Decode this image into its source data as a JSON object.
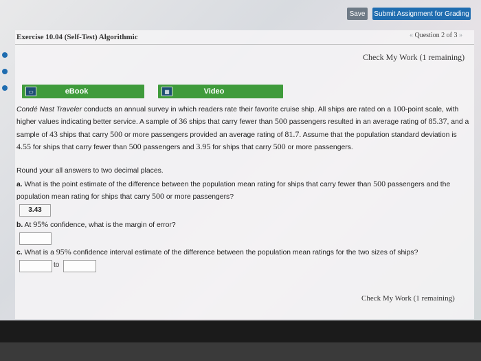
{
  "toolbar": {
    "save_label": "Save",
    "submit_label": "Submit Assignment for Grading"
  },
  "header": {
    "exercise_title": "Exercise 10.04 (Self-Test) Algorithmic",
    "question_nav": "Question 2 of 3",
    "prev_arrow": "«",
    "next_arrow": "»",
    "check_my_work_top": "Check My Work (1 remaining)"
  },
  "resources": {
    "ebook_label": "eBook",
    "video_label": "Video"
  },
  "problem": {
    "p1_brand": "Condé Nast Traveler",
    "p1_text1": " conducts an annual survey in which readers rate their favorite cruise ship. All ships are rated on a ",
    "n100": "100",
    "p1_text2": "-point scale, with higher values indicating better service. A sample of ",
    "n36": "36",
    "p1_text3": " ships that carry fewer than ",
    "n500a": "500",
    "p1_text4": " passengers resulted in an average rating of ",
    "n8537": "85.37",
    "p1_text5": ", and a sample of ",
    "n43": "43",
    "p1_text6": " ships that carry ",
    "n500b": "500",
    "p1_text7": " or more passengers provided an average rating of ",
    "n817": "81.7",
    "p1_text8": ". Assume that the population standard deviation is ",
    "n455": "4.55",
    "p1_text9": " for ships that carry fewer than ",
    "n500c": "500",
    "p1_text10": " passengers and ",
    "n395": "3.95",
    "p1_text11": " for ships that carry ",
    "n500d": "500",
    "p1_text12": " or more passengers.",
    "round_note": "Round your all answers to two decimal places."
  },
  "qa": {
    "a_label": "a.",
    "a_text1": " What is the point estimate of the difference between the population mean rating for ships that carry fewer than ",
    "a_n500a": "500",
    "a_text2": " passengers and the population mean rating for ships that carry ",
    "a_n500b": "500",
    "a_text3": " or more passengers?",
    "a_answer": "3.43",
    "b_label": "b.",
    "b_text1": " At ",
    "b_pct": "95%",
    "b_text2": " confidence, what is the margin of error?",
    "b_value": "",
    "c_label": "c.",
    "c_text1": " What is a ",
    "c_pct": "95%",
    "c_text2": " confidence interval estimate of the difference between the population mean ratings for the two sizes of ships?",
    "c_to": "to",
    "c_low": "",
    "c_high": ""
  },
  "footer": {
    "check_my_work_bottom": "Check My Work (1 remaining)"
  }
}
